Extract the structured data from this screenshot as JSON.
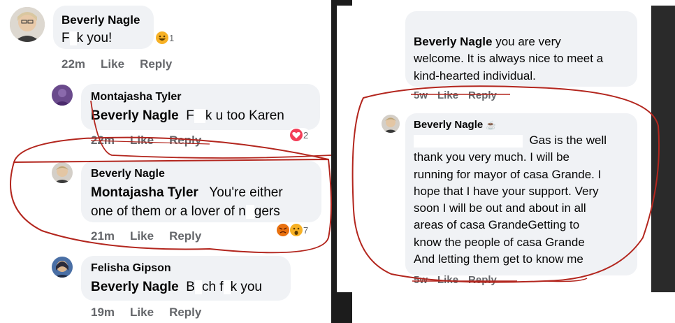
{
  "left": {
    "comments": [
      {
        "author": "Beverly Nagle",
        "mention": "",
        "text_before": "F",
        "text_after": "k you!",
        "time": "22m",
        "like": "Like",
        "reply": "Reply",
        "reaction_count": "1"
      },
      {
        "author": "Montajasha Tyler",
        "mention": "Beverly Nagle",
        "text_before": "F",
        "text_after": "k u too Karen",
        "time": "22m",
        "like": "Like",
        "reply": "Reply",
        "reaction_count": "2"
      },
      {
        "author": "Beverly Nagle",
        "mention": "Montajasha Tyler",
        "text_line1": "You're either",
        "text_line2_before": "one of them or a lover of n",
        "text_line2_after": "gers",
        "time": "21m",
        "like": "Like",
        "reply": "Reply",
        "reaction_count": "7"
      },
      {
        "author": "Felisha Gipson",
        "mention": "Beverly Nagle",
        "text_before": "B",
        "text_mid": "ch f",
        "text_after": "k you",
        "time": "19m",
        "like": "Like",
        "reply": "Reply"
      }
    ]
  },
  "right": {
    "comments": [
      {
        "mention": "Beverly Nagle",
        "lines": [
          "you are very",
          "welcome. It is always nice to meet a",
          "kind-hearted individual."
        ],
        "time": "5w",
        "like": "Like",
        "reply": "Reply"
      },
      {
        "author": "Beverly Nagle",
        "lines": [
          "Gas is the well",
          "thank you very much. I will be",
          "running for mayor of casa Grande. I",
          "hope that I have your support. Very",
          "soon I will be out and about in all",
          "areas of casa GrandeGetting to",
          "know the people of casa Grande",
          "And letting them get to know me"
        ],
        "time": "5w",
        "like": "Like",
        "reply": "Reply"
      }
    ]
  },
  "colors": {
    "bubble": "#f0f2f5",
    "meta": "#65676b",
    "annotation": "#b3261e",
    "love": "#f33e58",
    "haha": "#f7b125",
    "angry": "#e9710f"
  }
}
